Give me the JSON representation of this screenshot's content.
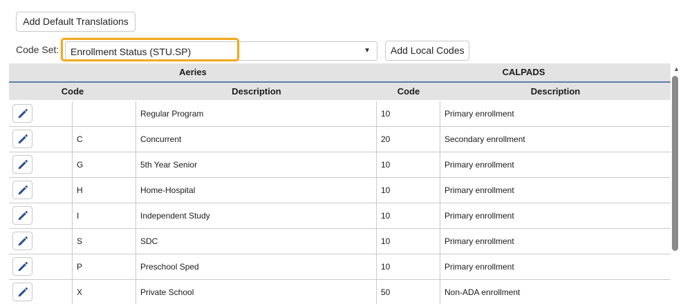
{
  "toolbar": {
    "add_default_label": "Add Default Translations",
    "add_local_label": "Add Local Codes"
  },
  "code_set": {
    "label": "Code Set:",
    "selected": "Enrollment Status (STU.SP)",
    "caret_glyph": "▼"
  },
  "table": {
    "groups": {
      "aeries": "Aeries",
      "calpads": "CALPADS"
    },
    "columns": {
      "aeries_code": "Code",
      "aeries_description": "Description",
      "calpads_code": "Code",
      "calpads_description": "Description"
    },
    "rows": [
      {
        "aeries_code": "",
        "aeries_description": "Regular Program",
        "calpads_code": "10",
        "calpads_description": "Primary enrollment"
      },
      {
        "aeries_code": "C",
        "aeries_description": "Concurrent",
        "calpads_code": "20",
        "calpads_description": "Secondary enrollment"
      },
      {
        "aeries_code": "G",
        "aeries_description": "5th Year Senior",
        "calpads_code": "10",
        "calpads_description": "Primary enrollment"
      },
      {
        "aeries_code": "H",
        "aeries_description": "Home-Hospital",
        "calpads_code": "10",
        "calpads_description": "Primary enrollment"
      },
      {
        "aeries_code": "I",
        "aeries_description": "Independent Study",
        "calpads_code": "10",
        "calpads_description": "Primary enrollment"
      },
      {
        "aeries_code": "S",
        "aeries_description": "SDC",
        "calpads_code": "10",
        "calpads_description": "Primary enrollment"
      },
      {
        "aeries_code": "P",
        "aeries_description": "Preschool Sped",
        "calpads_code": "10",
        "calpads_description": "Primary enrollment"
      },
      {
        "aeries_code": "X",
        "aeries_description": "Private School",
        "calpads_code": "50",
        "calpads_description": "Non-ADA enrollment"
      }
    ]
  },
  "icons": {
    "edit": "pencil-icon",
    "scroll_up": "chevron-up-icon"
  },
  "scroll_up_glyph": "▲",
  "colors": {
    "highlight": "#f0aa22",
    "edit_icon": "#2b4f8f",
    "header_bg": "#e3e3e3",
    "header_rule": "#5b7fa6"
  }
}
